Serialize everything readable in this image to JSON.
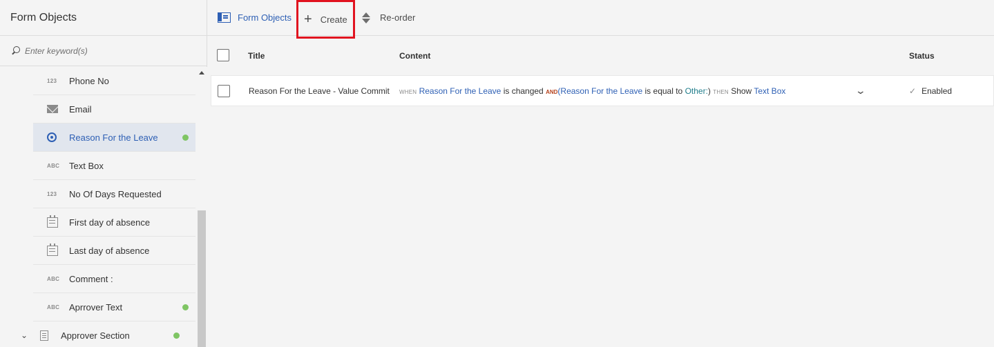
{
  "sidebar": {
    "title": "Form Objects",
    "search": {
      "placeholder": "Enter keyword(s)",
      "value": ""
    },
    "items": [
      {
        "label": "Phone No",
        "icon": "numeric-icon",
        "icon_text": "123",
        "has_rule": false,
        "selected": false
      },
      {
        "label": "Email",
        "icon": "envelope-icon",
        "icon_text": "",
        "has_rule": false,
        "selected": false
      },
      {
        "label": "Reason For the Leave",
        "icon": "radio-icon",
        "icon_text": "",
        "has_rule": true,
        "selected": true
      },
      {
        "label": "Text Box",
        "icon": "text-field-icon",
        "icon_text": "ABC",
        "has_rule": false,
        "selected": false
      },
      {
        "label": "No Of Days Requested",
        "icon": "numeric-icon",
        "icon_text": "123",
        "has_rule": false,
        "selected": false
      },
      {
        "label": "First day of absence",
        "icon": "calendar-icon",
        "icon_text": "",
        "has_rule": false,
        "selected": false
      },
      {
        "label": "Last day of absence",
        "icon": "calendar-icon",
        "icon_text": "",
        "has_rule": false,
        "selected": false
      },
      {
        "label": "Comment :",
        "icon": "text-field-icon",
        "icon_text": "ABC",
        "has_rule": false,
        "selected": false
      },
      {
        "label": "Aprrover Text",
        "icon": "text-field-icon",
        "icon_text": "ABC",
        "has_rule": true,
        "selected": false
      }
    ],
    "section": {
      "label": "Approver Section",
      "icon": "panel-doc-icon",
      "chevron": "⌄",
      "has_rule": true
    }
  },
  "toolbar": {
    "form_objects_label": "Form Objects",
    "create_label": "Create",
    "create_icon": "+",
    "reorder_label": "Re-order"
  },
  "table": {
    "headers": {
      "title": "Title",
      "content": "Content",
      "status": "Status"
    },
    "rows": [
      {
        "title": "Reason For the Leave - Value Commit",
        "content": {
          "when": "WHEN",
          "field1": "Reason For the Leave",
          "changed": "is changed",
          "and": "AND",
          "open_paren": "(",
          "field2": "Reason For the Leave",
          "equal": "is equal to",
          "value": "Other:",
          "close_paren": ")",
          "then": "THEN",
          "action": "Show",
          "target": "Text Box"
        },
        "expand_icon": "⌄",
        "status_icon": "✓",
        "status": "Enabled"
      }
    ]
  },
  "colors": {
    "accent": "#2d5fb4",
    "rule_dot": "#7fc564",
    "highlight_box": "#e1131f",
    "and_keyword": "#b5421d"
  }
}
